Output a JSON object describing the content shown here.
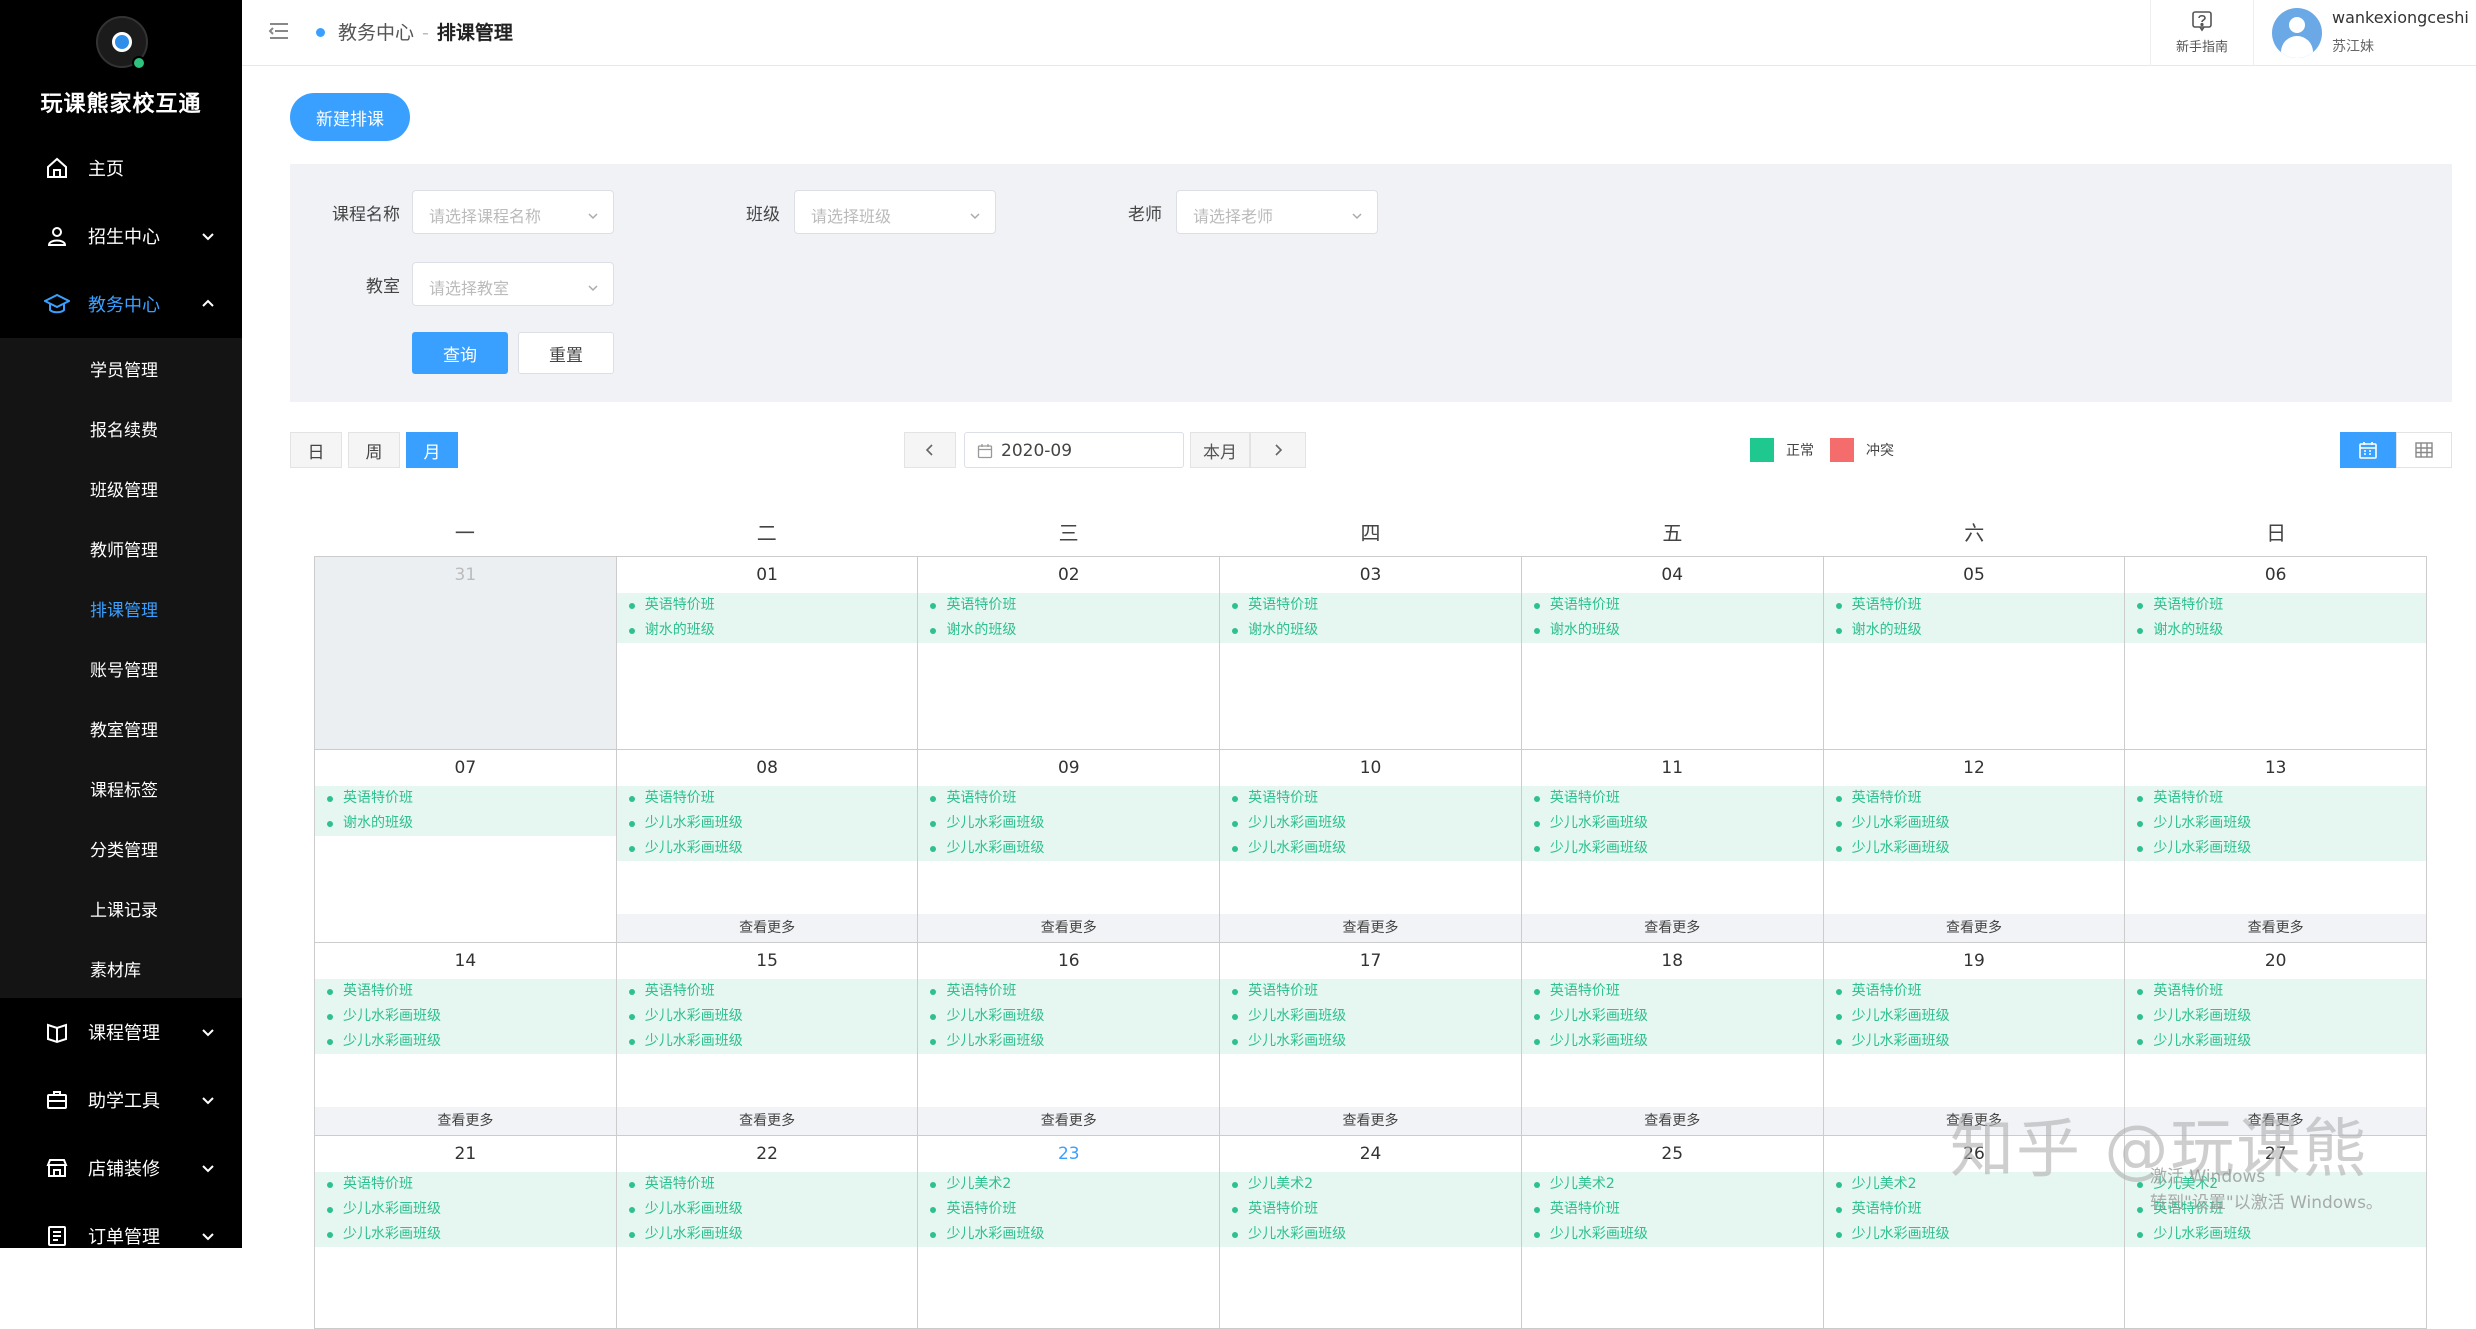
{
  "app": {
    "name": "玩课熊家校互通"
  },
  "sidebar": {
    "items": [
      {
        "label": "主页",
        "icon": "home-icon"
      },
      {
        "label": "招生中心",
        "icon": "user-icon"
      },
      {
        "label": "教务中心",
        "icon": "graduation-cap-icon",
        "expanded": true,
        "children": [
          "学员管理",
          "报名续费",
          "班级管理",
          "教师管理",
          "排课管理",
          "账号管理",
          "教室管理",
          "课程标签",
          "分类管理",
          "上课记录",
          "素材库"
        ],
        "active_child": "排课管理"
      },
      {
        "label": "课程管理",
        "icon": "book-icon"
      },
      {
        "label": "助学工具",
        "icon": "toolbox-icon"
      },
      {
        "label": "店铺装修",
        "icon": "store-icon"
      },
      {
        "label": "订单管理",
        "icon": "order-icon"
      }
    ]
  },
  "header": {
    "breadcrumb": [
      "教务中心",
      "排课管理"
    ],
    "separator": "-",
    "help_label": "新手指南",
    "user_name": "wankexiongceshi",
    "user_location": "苏江妹"
  },
  "toolbar": {
    "new_button": "新建排课"
  },
  "filters": {
    "course_label": "课程名称",
    "course_placeholder": "请选择课程名称",
    "class_label": "班级",
    "class_placeholder": "请选择班级",
    "teacher_label": "老师",
    "teacher_placeholder": "请选择老师",
    "room_label": "教室",
    "room_placeholder": "请选择教室",
    "query_button": "查询",
    "reset_button": "重置"
  },
  "calendar_nav": {
    "views": [
      "日",
      "周",
      "月"
    ],
    "active_view": "月",
    "month": "2020-09",
    "this_month": "本月",
    "prev": "‹",
    "next": "›"
  },
  "legend": [
    {
      "label": "正常",
      "color": "#1ec88f"
    },
    {
      "label": "冲突",
      "color": "#f56c6c"
    }
  ],
  "colors": {
    "accent": "#3aa0ff",
    "event_text": "#2ec08f",
    "event_bg": "#e6f7f1"
  },
  "calendar": {
    "weekdays": [
      "一",
      "二",
      "三",
      "四",
      "五",
      "六",
      "日"
    ],
    "more_label": "查看更多",
    "weeks": [
      [
        {
          "day": "31",
          "other": true,
          "events": []
        },
        {
          "day": "01",
          "events": [
            "英语特价班",
            "谢水的班级"
          ]
        },
        {
          "day": "02",
          "events": [
            "英语特价班",
            "谢水的班级"
          ]
        },
        {
          "day": "03",
          "events": [
            "英语特价班",
            "谢水的班级"
          ]
        },
        {
          "day": "04",
          "events": [
            "英语特价班",
            "谢水的班级"
          ]
        },
        {
          "day": "05",
          "events": [
            "英语特价班",
            "谢水的班级"
          ]
        },
        {
          "day": "06",
          "events": [
            "英语特价班",
            "谢水的班级"
          ]
        }
      ],
      [
        {
          "day": "07",
          "events": [
            "英语特价班",
            "谢水的班级"
          ]
        },
        {
          "day": "08",
          "events": [
            "英语特价班",
            "少儿水彩画班级",
            "少儿水彩画班级"
          ],
          "more": true
        },
        {
          "day": "09",
          "events": [
            "英语特价班",
            "少儿水彩画班级",
            "少儿水彩画班级"
          ],
          "more": true
        },
        {
          "day": "10",
          "events": [
            "英语特价班",
            "少儿水彩画班级",
            "少儿水彩画班级"
          ],
          "more": true
        },
        {
          "day": "11",
          "events": [
            "英语特价班",
            "少儿水彩画班级",
            "少儿水彩画班级"
          ],
          "more": true
        },
        {
          "day": "12",
          "events": [
            "英语特价班",
            "少儿水彩画班级",
            "少儿水彩画班级"
          ],
          "more": true
        },
        {
          "day": "13",
          "events": [
            "英语特价班",
            "少儿水彩画班级",
            "少儿水彩画班级"
          ],
          "more": true
        }
      ],
      [
        {
          "day": "14",
          "events": [
            "英语特价班",
            "少儿水彩画班级",
            "少儿水彩画班级"
          ],
          "more": true
        },
        {
          "day": "15",
          "events": [
            "英语特价班",
            "少儿水彩画班级",
            "少儿水彩画班级"
          ],
          "more": true
        },
        {
          "day": "16",
          "events": [
            "英语特价班",
            "少儿水彩画班级",
            "少儿水彩画班级"
          ],
          "more": true
        },
        {
          "day": "17",
          "events": [
            "英语特价班",
            "少儿水彩画班级",
            "少儿水彩画班级"
          ],
          "more": true
        },
        {
          "day": "18",
          "events": [
            "英语特价班",
            "少儿水彩画班级",
            "少儿水彩画班级"
          ],
          "more": true
        },
        {
          "day": "19",
          "events": [
            "英语特价班",
            "少儿水彩画班级",
            "少儿水彩画班级"
          ],
          "more": true
        },
        {
          "day": "20",
          "events": [
            "英语特价班",
            "少儿水彩画班级",
            "少儿水彩画班级"
          ],
          "more": true
        }
      ],
      [
        {
          "day": "21",
          "events": [
            "英语特价班",
            "少儿水彩画班级",
            "少儿水彩画班级"
          ]
        },
        {
          "day": "22",
          "events": [
            "英语特价班",
            "少儿水彩画班级",
            "少儿水彩画班级"
          ]
        },
        {
          "day": "23",
          "today": true,
          "events": [
            "少儿美术2",
            "英语特价班",
            "少儿水彩画班级"
          ]
        },
        {
          "day": "24",
          "events": [
            "少儿美术2",
            "英语特价班",
            "少儿水彩画班级"
          ]
        },
        {
          "day": "25",
          "events": [
            "少儿美术2",
            "英语特价班",
            "少儿水彩画班级"
          ]
        },
        {
          "day": "26",
          "events": [
            "少儿美术2",
            "英语特价班",
            "少儿水彩画班级"
          ]
        },
        {
          "day": "27",
          "events": [
            "少儿美术2",
            "英语特价班",
            "少儿水彩画班级"
          ]
        }
      ]
    ]
  },
  "watermark": {
    "text": "知乎 @玩课熊",
    "activate_line1": "激活 Windows",
    "activate_line2": "转到\"设置\"以激活 Windows。"
  }
}
